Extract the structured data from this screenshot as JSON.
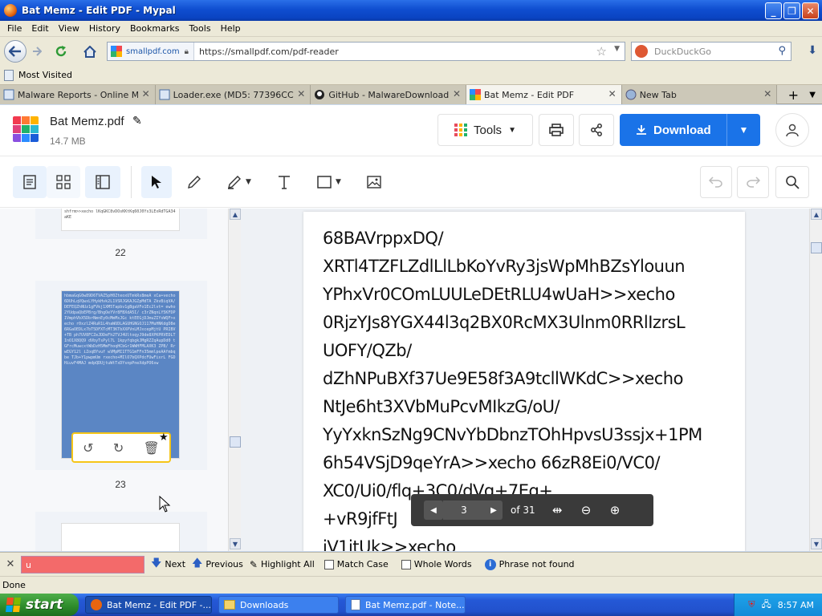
{
  "window": {
    "title": "Bat Memz - Edit PDF - Mypal"
  },
  "menu": [
    "File",
    "Edit",
    "View",
    "History",
    "Bookmarks",
    "Tools",
    "Help"
  ],
  "nav": {
    "site_badge": "smallpdf.com",
    "url": "https://smallpdf.com/pdf-reader",
    "search_placeholder": "DuckDuckGo"
  },
  "bookmarks": {
    "most_visited": "Most Visited"
  },
  "tabs": [
    {
      "label": "Malware Reports - Online Mal...",
      "active": false
    },
    {
      "label": "Loader.exe (MD5: 77396CCF...",
      "active": false
    },
    {
      "label": "GitHub - MalwareDownload/Vi...",
      "active": false
    },
    {
      "label": "Bat Memz - Edit PDF",
      "active": true
    },
    {
      "label": "New Tab",
      "active": false
    }
  ],
  "app": {
    "file_name": "Bat Memz.pdf",
    "file_size": "14.7 MB",
    "tools_label": "Tools",
    "download_label": "Download"
  },
  "thumbnails": {
    "page_22_label": "22",
    "page_23_label": "23",
    "page_22_text": "shfrm>>xecho lKqGKC8vDOsKKtKq60J0Ys3LExRdTGA34aKE",
    "page_23_text": "hbmaGqG0w89D6TVAZ5pH0ZteoxUTmkRx8meA xCa+vecho 6DUhLqVQwxLYHykHvk2L1VSRJGKAJGZpMdTA ZkvBiqVA/ DEFEQZhNUz1gFVkj1XM5Tapbv1gBgaVFo1Ec2lvt= ewho 2YUdpaQbEPBrg/BhgOeYVr8FBXdA5I/ c3rZNqnLY5KFDPIVmphVbX5DbrNmnEy0cMmMxJGc ktEEGjDJmuZIYsWQF>xecho r0xzlZ4RuR1L4haWUDLAGUHGNGOJ117MuHNKdgD8e 6RGaOEDLx7bT5DFXTcMT3KTbXXPVnLMJxcepMjtU PRIBV+TB ph7UV8FCZeJDDeFh2TVJ4UltoqyJ9de8XPKPRVEDLT InO1X8QQ9 dVbyTsPyl7L 1kpyfqbgkJMgRZZqAupDd0 tGFrcMuwcxtWbDzH5MmFhoqHCbGr1WWHFMLAXK3 ZPB/ RrwEGY12l iZoqBYvuf wVMpMI1TTG1mFFn35mmlpeAAfmbqbe TJb+Y1pwpmUm rxecho+MIlO7bQXPdcFUwFixrL FGDHiuvF4MAJ mdpQDUjtuWtTxDYsnpPneXdpPO6sw"
  },
  "page_view": {
    "lines": [
      "68BAVrppxDQ/",
      "XRTl4TZFLZdlLlLbKoYvRy3jsWpMhBZsYlouun",
      "YPhxVr0COmLUULeDEtRLU4wUaH>>xecho",
      "0RjzYJs8YGX44l3q2BX0RcMX3Ulnm0RRlIzrsL",
      "UOFY/QZb/",
      "dZhNPuBXf37Ue9E58f3A9tcllWKdC>>xecho",
      "NtJe6ht3XVbMuPcvMIkzG/oU/",
      "YyYxknSzNg9CNvYbDbnzTOhHpvsU3ssjx+1PM",
      "6h54VSjD9qeYrA>>xecho 66zR8Ei0/VC0/",
      "XC0/Ui0/flq+3C0/dVq+7Eq+",
      "+vR9jfFtJ                          ",
      "jV1jtUk>>xecho"
    ],
    "current_page": "3",
    "total_pages": "of 31"
  },
  "find": {
    "query": "u",
    "next": "Next",
    "previous": "Previous",
    "highlight_all": "Highlight All",
    "match_case": "Match Case",
    "whole_words": "Whole Words",
    "status": "Phrase not found"
  },
  "status_text": "Done",
  "taskbar": {
    "start": "start",
    "tasks": [
      "Bat Memz - Edit PDF -...",
      "Downloads",
      "Bat Memz.pdf - Note..."
    ],
    "clock": "8:57 AM"
  }
}
